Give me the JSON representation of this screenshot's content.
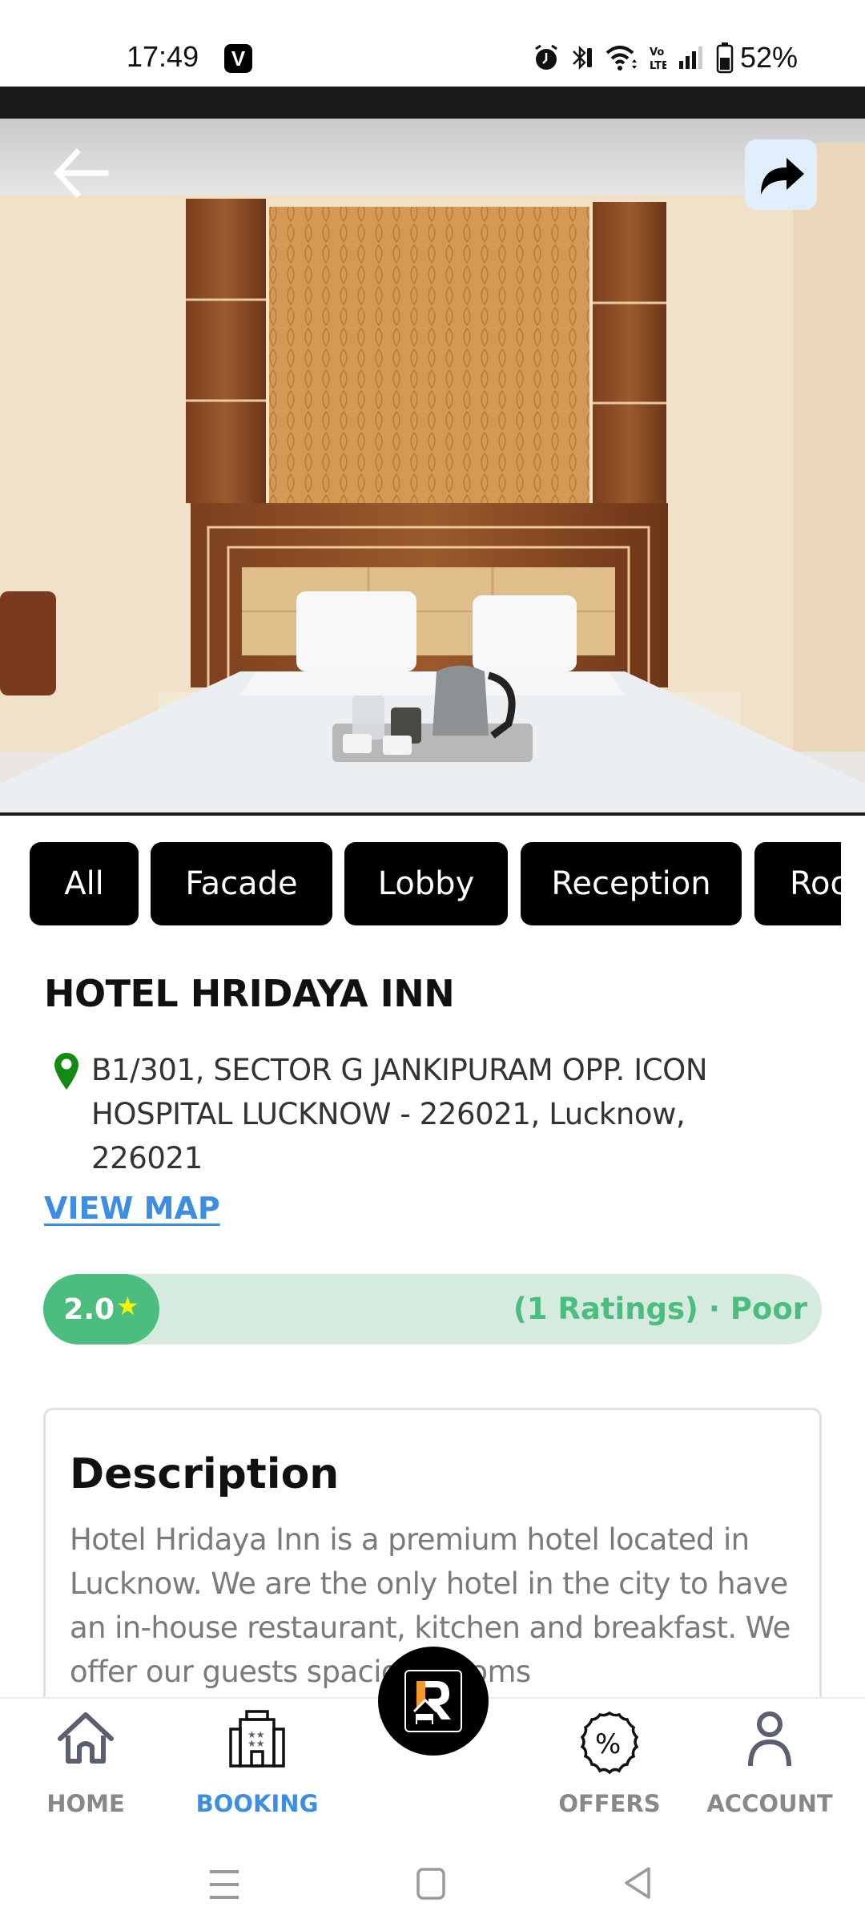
{
  "status_bar": {
    "time": "17:49",
    "notification_badge": "V",
    "battery_percent": "52%",
    "icons": [
      "alarm-icon",
      "bluetooth-icon",
      "wifi-icon",
      "volte-icon",
      "signal-icon",
      "battery-icon"
    ]
  },
  "hero": {
    "image_alt": "Hotel room with double bed and kettle tray",
    "back_icon": "arrow-left-icon",
    "share_icon": "share-arrow-icon"
  },
  "gallery_tabs": [
    {
      "label": "All"
    },
    {
      "label": "Facade"
    },
    {
      "label": "Lobby"
    },
    {
      "label": "Reception"
    },
    {
      "label": "Room"
    }
  ],
  "hotel": {
    "name": "HOTEL HRIDAYA INN",
    "address": "B1/301, SECTOR G JANKIPURAM OPP. ICON HOSPITAL LUCKNOW - 226021, Lucknow, 226021",
    "view_map_label": "VIEW MAP"
  },
  "rating": {
    "value": "2.0",
    "star": "★",
    "summary": "(1 Ratings) · Poor",
    "colors": {
      "pill": "#4bbd7e",
      "bar": "#d6ebe0",
      "star": "#f5f500"
    }
  },
  "description": {
    "title": "Description",
    "body": "Hotel Hridaya Inn is a premium hotel located in Lucknow. We are the only hotel in the city to have an in-house restaurant, kitchen and breakfast. We offer our guests spacious rooms"
  },
  "bottom_nav": {
    "items": [
      {
        "label": "HOME",
        "icon": "home-icon",
        "active": false
      },
      {
        "label": "BOOKING",
        "icon": "hotel-building-icon",
        "active": true
      },
      {
        "label": "OFFERS",
        "icon": "discount-badge-icon",
        "active": false
      },
      {
        "label": "ACCOUNT",
        "icon": "user-icon",
        "active": false
      }
    ],
    "center_button_icon": "app-logo-icon",
    "active_color": "#3d8ee0"
  },
  "system_nav": {
    "buttons": [
      "recents-icon",
      "home-square-icon",
      "back-triangle-icon"
    ]
  }
}
